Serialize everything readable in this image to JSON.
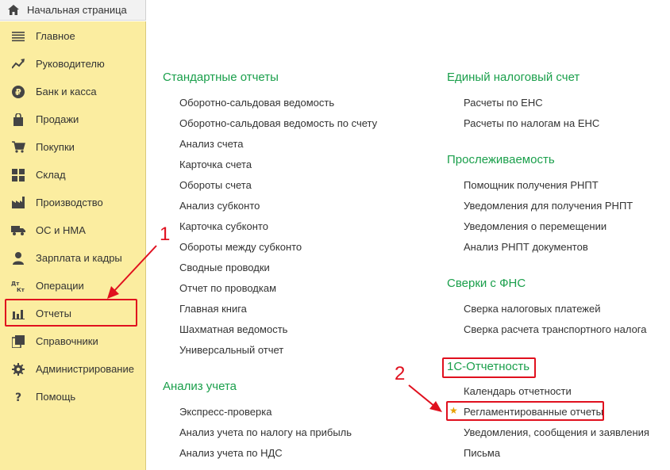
{
  "home": {
    "label": "Начальная страница",
    "icon": "home-icon"
  },
  "sidebar": {
    "items": [
      {
        "label": "Главное",
        "icon": "menu-lines-icon"
      },
      {
        "label": "Руководителю",
        "icon": "trend-chart-icon"
      },
      {
        "label": "Банк и касса",
        "icon": "ruble-coin-icon"
      },
      {
        "label": "Продажи",
        "icon": "shopping-bag-icon"
      },
      {
        "label": "Покупки",
        "icon": "shopping-cart-icon"
      },
      {
        "label": "Склад",
        "icon": "warehouse-grid-icon"
      },
      {
        "label": "Производство",
        "icon": "factory-icon"
      },
      {
        "label": "ОС и НМА",
        "icon": "truck-icon"
      },
      {
        "label": "Зарплата и кадры",
        "icon": "person-icon"
      },
      {
        "label": "Операции",
        "icon": "debit-credit-icon"
      },
      {
        "label": "Отчеты",
        "icon": "bar-chart-icon"
      },
      {
        "label": "Справочники",
        "icon": "books-icon"
      },
      {
        "label": "Администрирование",
        "icon": "gear-icon"
      },
      {
        "label": "Помощь",
        "icon": "question-icon"
      }
    ]
  },
  "left_column": {
    "sections": [
      {
        "title": "Стандартные отчеты",
        "links": [
          "Оборотно-сальдовая ведомость",
          "Оборотно-сальдовая ведомость по счету",
          "Анализ счета",
          "Карточка счета",
          "Обороты счета",
          "Анализ субконто",
          "Карточка субконто",
          "Обороты между субконто",
          "Сводные проводки",
          "Отчет по проводкам",
          "Главная книга",
          "Шахматная ведомость",
          "Универсальный отчет"
        ]
      },
      {
        "title": "Анализ учета",
        "links": [
          "Экспресс-проверка",
          "Анализ учета по налогу на прибыль",
          "Анализ учета по НДС"
        ]
      }
    ]
  },
  "right_column": {
    "sections": [
      {
        "title": "Единый налоговый счет",
        "links": [
          "Расчеты по ЕНС",
          "Расчеты по налогам на ЕНС"
        ]
      },
      {
        "title": "Прослеживаемость",
        "links": [
          "Помощник получения РНПТ",
          "Уведомления для получения РНПТ",
          "Уведомления о перемещении",
          "Анализ РНПТ документов"
        ]
      },
      {
        "title": "Сверки с ФНС",
        "links": [
          "Сверка налоговых платежей",
          "Сверка расчета транспортного налога"
        ]
      },
      {
        "title": "1С-Отчетность",
        "links": [
          "Календарь отчетности",
          "Регламентированные отчеты",
          "Уведомления, сообщения и заявления",
          "Письма"
        ]
      }
    ]
  },
  "annotations": {
    "step1": "1",
    "step2": "2",
    "color": "#e0101e"
  },
  "colors": {
    "sidebar_bg": "#fbeda0",
    "section_title": "#1a9f4b",
    "favorite_star": "#e6a100"
  }
}
